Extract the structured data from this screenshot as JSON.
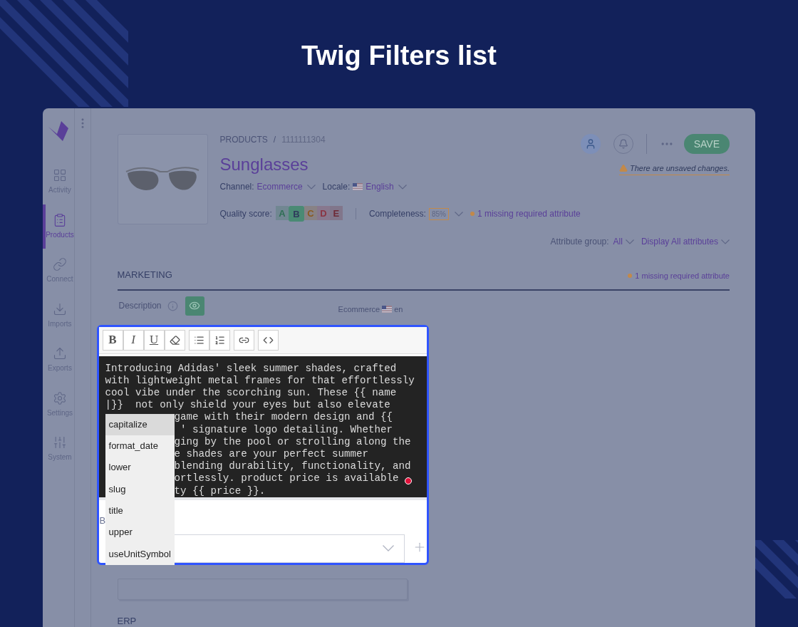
{
  "banner": {
    "title": "Twig Filters list"
  },
  "sidebar": {
    "items": [
      {
        "label": "Activity",
        "selected": false
      },
      {
        "label": "Products",
        "selected": true
      },
      {
        "label": "Connect",
        "selected": false
      },
      {
        "label": "Imports",
        "selected": false
      },
      {
        "label": "Exports",
        "selected": false
      },
      {
        "label": "Settings",
        "selected": false
      },
      {
        "label": "System",
        "selected": false
      }
    ]
  },
  "header": {
    "breadcrumb": [
      "PRODUCTS",
      "/",
      "1111111304"
    ],
    "title": "Sunglasses",
    "channel": {
      "label": "Channel:",
      "value": "Ecommerce"
    },
    "locale": {
      "label": "Locale:",
      "value": "English"
    },
    "quality_score": {
      "label": "Quality score:",
      "grades": [
        {
          "label": "A",
          "color": "#2f6e55",
          "selected": false
        },
        {
          "label": "B",
          "color": "#4a8a74",
          "selected": true
        },
        {
          "label": "C",
          "color": "#8a5a20",
          "selected": false
        },
        {
          "label": "D",
          "color": "#8a3443",
          "selected": false
        },
        {
          "label": "E",
          "color": "#6e2a36",
          "selected": false
        }
      ]
    },
    "completeness": {
      "label": "Completeness:",
      "value": "85%"
    },
    "missing": "1 missing required attribute",
    "save": "SAVE",
    "unsaved": "There are unsaved changes."
  },
  "filters": {
    "attribute_group": {
      "label": "Attribute group:",
      "value": "All"
    },
    "display": "Display All attributes"
  },
  "section": {
    "title": "MARKETING",
    "missing": "1 missing required attribute"
  },
  "field": {
    "label": "Description",
    "scope": "Ecommerce",
    "locale": "en"
  },
  "editor": {
    "toolbar": [
      [
        {
          "kind": "bold",
          "label": "B"
        },
        {
          "kind": "italic",
          "label": "I"
        },
        {
          "kind": "underline",
          "label": "U"
        },
        {
          "kind": "eraser"
        }
      ],
      [
        {
          "kind": "bullets"
        },
        {
          "kind": "numbers"
        }
      ],
      [
        {
          "kind": "link"
        }
      ],
      [
        {
          "kind": "code"
        }
      ]
    ],
    "lines": [
      {
        "covered": false,
        "text": "Introducing Adidas' sleek summer shades, crafted"
      },
      {
        "covered": false,
        "text": "with lightweight metal frames for that effortlessly"
      },
      {
        "covered": false,
        "text": "cool vibe under the scorching sun. These {{ name"
      },
      {
        "covered": false,
        "text": "|}}  not only shield your eyes but also elevate"
      },
      {
        "covered": true,
        "text": "game with their modern design and {{"
      },
      {
        "covered": true,
        "text": " ' signature logo detailing. Whether"
      },
      {
        "covered": true,
        "text": "ging by the pool or strolling along the"
      },
      {
        "covered": true,
        "text": "e shades are your perfect summer"
      },
      {
        "covered": true,
        "text": "blending durability, functionality, and"
      },
      {
        "covered": true,
        "text": "ortlessly. product price is available"
      },
      {
        "covered": true,
        "text": "ty {{ price }}."
      }
    ],
    "label": "B",
    "suggestions": [
      {
        "label": "capitalize",
        "selected": true
      },
      {
        "label": "format_date",
        "selected": false
      },
      {
        "label": "lower",
        "selected": false
      },
      {
        "label": "slug",
        "selected": false
      },
      {
        "label": "title",
        "selected": false
      },
      {
        "label": "upper",
        "selected": false
      },
      {
        "label": "useUnitSymbol",
        "selected": false
      }
    ]
  },
  "next_section": {
    "title": "ERP"
  }
}
